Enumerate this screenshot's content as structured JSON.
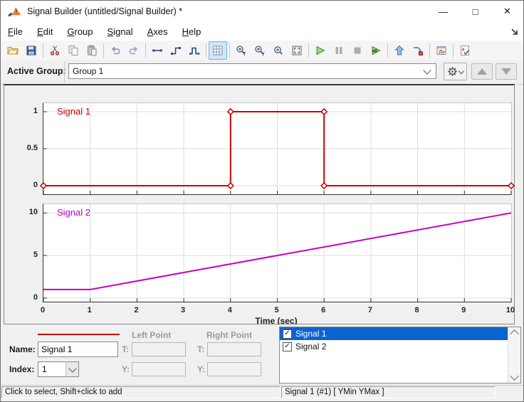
{
  "window": {
    "title": "Signal Builder (untitled/Signal Builder) *",
    "controls": {
      "minimize": "—",
      "maximize": "□",
      "close": "✕"
    }
  },
  "menubar": {
    "items": [
      {
        "first": "F",
        "rest": "ile"
      },
      {
        "first": "E",
        "rest": "dit"
      },
      {
        "first": "G",
        "rest": "roup"
      },
      {
        "first": "S",
        "rest": "ignal"
      },
      {
        "first": "A",
        "rest": "xes"
      },
      {
        "first": "H",
        "rest": "elp"
      }
    ]
  },
  "toolbar": {
    "buttons": [
      "open",
      "save",
      "cut",
      "copy",
      "paste",
      "undo",
      "redo",
      "draw-line",
      "draw-step",
      "draw-pulse",
      "grid",
      "zoom-time",
      "zoom-y",
      "zoom-in",
      "fit-view",
      "play",
      "pause",
      "stop",
      "play-all",
      "up-to-parent",
      "goto-block",
      "show-signal-dialog",
      "verify"
    ],
    "toggled": "grid",
    "disabled": [
      "pause",
      "stop"
    ]
  },
  "group_bar": {
    "label": "Active Group:",
    "value": "Group 1"
  },
  "chart_data": {
    "type": "line",
    "xlabel": "Time (sec)",
    "xticks": [
      0,
      1,
      2,
      3,
      4,
      5,
      6,
      7,
      8,
      9,
      10
    ],
    "plots": [
      {
        "name": "Signal 1",
        "color": "#cc0000",
        "x": [
          0,
          4,
          4,
          6,
          6,
          10
        ],
        "y": [
          0,
          0,
          1,
          1,
          0,
          0
        ],
        "markers": "diamond",
        "xlim": [
          0,
          10
        ],
        "ylim": [
          -0.115,
          1.115
        ],
        "yticks": [
          1,
          0.5,
          0
        ],
        "grid_x": [
          1,
          2,
          3,
          4,
          5,
          6,
          7,
          8,
          9
        ]
      },
      {
        "name": "Signal 2",
        "color": "#c400c4",
        "x": [
          0,
          1,
          10
        ],
        "y": [
          1,
          1,
          10
        ],
        "markers": "none",
        "xlim": [
          0,
          10
        ],
        "ylim": [
          -0.43,
          11.03
        ],
        "yticks": [
          10,
          5,
          0
        ],
        "grid_x": [
          1,
          2,
          3,
          4,
          5,
          6,
          7,
          8,
          9
        ]
      }
    ]
  },
  "properties": {
    "name_label": "Name:",
    "name_value": "Signal 1",
    "index_label": "Index:",
    "index_value": "1",
    "left_point_title": "Left Point",
    "right_point_title": "Right Point",
    "t_label": "T:",
    "y_label": "Y:",
    "left_t": "",
    "left_y": "",
    "right_t": "",
    "right_y": ""
  },
  "signal_list": {
    "items": [
      {
        "label": "Signal 1",
        "checked": true,
        "selected": true
      },
      {
        "label": "Signal 2",
        "checked": true,
        "selected": false
      }
    ]
  },
  "statusbar": {
    "left": "Click to select, Shift+click to add",
    "right": "Signal 1 (#1)  [ YMin YMax ]"
  },
  "colors": {
    "signal1": "#cc0000",
    "signal2": "#c400c4",
    "selection": "#0a64d0",
    "grid_toggle_bg": "#cfe6f8"
  }
}
